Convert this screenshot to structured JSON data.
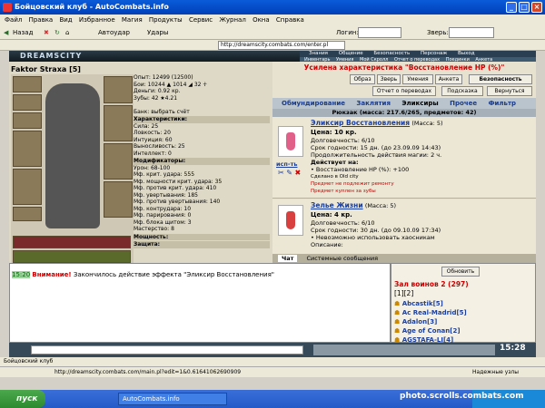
{
  "window": {
    "title": "Бойцовский клуб - AutoCombats.info"
  },
  "menu": [
    "Файл",
    "Правка",
    "Вид",
    "Избранное",
    "Магия",
    "Продукты",
    "Сервис",
    "Журнал",
    "Окна",
    "Справка"
  ],
  "toolbar": {
    "back": "Назад",
    "autoudar": "Автоудар",
    "udary": "Удары",
    "login_label": "Логин:",
    "zver_label": "Зверь:"
  },
  "address": {
    "url": "http://dreamscity.combats.com/enter.pl"
  },
  "topnav": {
    "items": [
      "Знания",
      "Общение",
      "Безопасность",
      "Персонаж",
      "Выход"
    ],
    "sub": [
      "Инвентарь",
      "Умения",
      "Мой Скролл",
      "Отчет о переводах",
      "Поединки",
      "Анкета"
    ]
  },
  "logo": "DREAMSCITY",
  "character": {
    "name": "Faktor Straxa",
    "level": "[5]"
  },
  "stats_top": [
    "Опыт: 12499 (12500)",
    "Бои: 10244 ▲ 1014 ◢ 32 ☥",
    "Деньги: 0.92 кр.",
    "Зубы: 42 ★4.21",
    "",
    "Банк: выбрать счёт"
  ],
  "characteristics": {
    "header": "Характеристики:",
    "rows": [
      "Сила: 25",
      "Ловкость: 20",
      "Интуиция: 60",
      "Выносливость: 25",
      "Интеллект: 0"
    ]
  },
  "modifiers": {
    "header": "Модификаторы:",
    "rows": [
      "Урон: 68-100",
      "Мф. крит. удара: 555",
      "Мф. мощности крит. удара: 35",
      "Мф. против крит. удара: 410",
      "Мф. увертывания: 185",
      "Мф. против увертывания: 140",
      "Мф. контрудара: 10",
      "Мф. парирования: 0",
      "Мф. блока щитом: 3",
      "Мастерство: 8"
    ]
  },
  "sections": {
    "power": "Мощность:",
    "defense": "Защита:"
  },
  "notice": "Усилена характеристика \"Восстановление HP (%)\"",
  "buttons": {
    "obraz": "Образ",
    "zver": "Зверь",
    "umeniya": "Умения",
    "anketa": "Анкета",
    "bezopasnost": "Безопасность",
    "report": "Отчет о переводах",
    "podskazka": "Подсказка",
    "vernutsya": "Вернуться",
    "refresh": "Обновить"
  },
  "tabs": [
    "Обмундирование",
    "Заклятия",
    "Эликсиры",
    "Прочее",
    "Фильтр"
  ],
  "backpack": "Рюкзак (масса: 217.6/265, предметов: 42)",
  "items": [
    {
      "name": "Эликсир Восстановления",
      "mass": "(Масса: 5)",
      "price": "Цена: 10 кр.",
      "lines": [
        "Долговечность: 6/10",
        "Срок годности: 15 дн. (до 23.09.09 14:43)",
        "Продолжительность действия магии: 2 ч.",
        "Действует на:",
        "• Восстановление HP (%): +100",
        "Сделано в Old city"
      ],
      "warn": [
        "Предмет не подлежит ремонту",
        "Предмет куплен за зубы"
      ],
      "use": "исп-ть"
    },
    {
      "name": "Зелье Жизни",
      "mass": "(Масса: 5)",
      "price": "Цена: 4 кр.",
      "lines": [
        "Долговечность: 6/10",
        "Срок годности: 30 дн. (до 09.10.09 17:34)",
        "• Невозможно использовать хаосникам",
        "Описание:"
      ],
      "warn": [],
      "use": "исп-ть"
    }
  ],
  "chat": {
    "tab_chat": "Чат",
    "tab_system": "Системные сообщения",
    "time": "15:20",
    "attention": "Внимание!",
    "message": "Закончилось действие эффекта \"Эликсир Восстановления\""
  },
  "who": {
    "title": "Зал воинов 2 (297)",
    "pages": "[1][2]",
    "players": [
      "Abcastik[5]",
      "Ac Real-Madrid[5]",
      "Adalon[3]",
      "Age of Conan[2]",
      "AGSTAFA-LI[4]"
    ]
  },
  "clock": "15:28",
  "status": {
    "tab": "Бойцовский клуб",
    "url": "http://dreamscity.combats.com/main.pl?edit=1&0.61641062690909",
    "zone": "Надежные узлы"
  },
  "taskbar": {
    "start": "пуск",
    "app": "AutoCombats.info",
    "watermark": "photo.scrolls.combats.com"
  }
}
